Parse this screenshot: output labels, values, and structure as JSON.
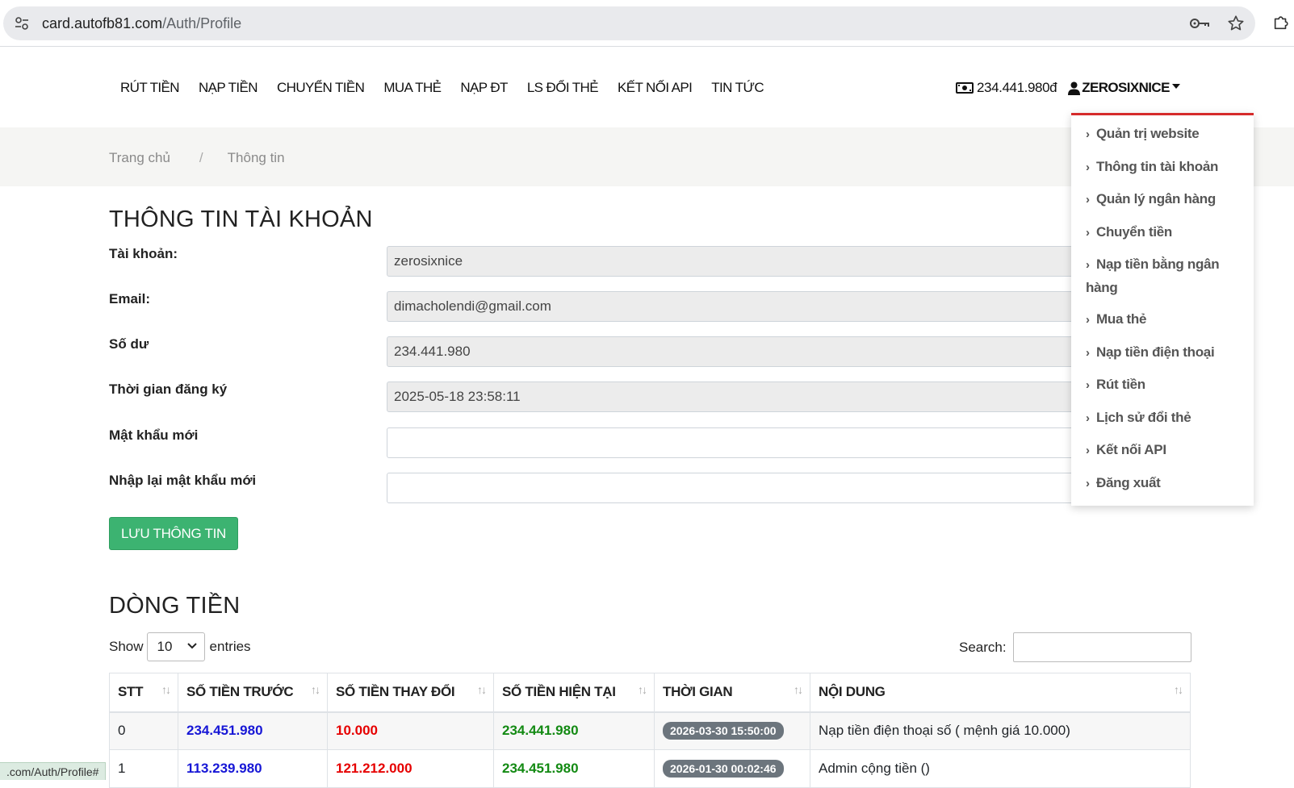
{
  "browser": {
    "url_host": "card.autofb81.com",
    "url_path": "/Auth/Profile",
    "status_url": ".com/Auth/Profile#"
  },
  "nav": {
    "links": [
      "RÚT TIỀN",
      "NẠP TIỀN",
      "CHUYỂN TIỀN",
      "MUA THẺ",
      "NẠP ĐT",
      "LS ĐỔI THẺ",
      "KẾT NỐI API",
      "TIN TỨC"
    ],
    "balance": "234.441.980đ",
    "username": "ZEROSIXNICE"
  },
  "breadcrumb": {
    "home": "Trang chủ",
    "separator": "/",
    "current": "Thông tin"
  },
  "account": {
    "title": "THÔNG TIN TÀI KHOẢN",
    "fields": [
      {
        "label": "Tài khoản:",
        "value": "zerosixnice"
      },
      {
        "label": "Email:",
        "value": "dimacholendi@gmail.com"
      },
      {
        "label": "Số dư",
        "value": "234.441.980"
      },
      {
        "label": "Thời gian đăng ký",
        "value": "2025-05-18 23:58:11"
      },
      {
        "label": "Mật khẩu mới",
        "value": ""
      },
      {
        "label": "Nhập lại mật khẩu mới",
        "value": ""
      }
    ],
    "save_label": "LƯU THÔNG TIN"
  },
  "cashflow": {
    "title": "DÒNG TIỀN",
    "show_label": "Show",
    "show_value": "10",
    "entries_label": "entries",
    "search_label": "Search:",
    "columns": [
      "STT",
      "SỐ TIỀN TRƯỚC",
      "SỐ TIỀN THAY ĐỔI",
      "SỐ TIỀN HIỆN TẠI",
      "THỜI GIAN",
      "NỘI DUNG"
    ],
    "rows": [
      {
        "stt": "0",
        "before": "234.451.980",
        "change": "10.000",
        "after": "234.441.980",
        "time": "2026-03-30 15:50:00",
        "content": "Nạp tiền điện thoại số ( mệnh giá 10.000)"
      },
      {
        "stt": "1",
        "before": "113.239.980",
        "change": "121.212.000",
        "after": "234.451.980",
        "time": "2026-01-30 00:02:46",
        "content": "Admin cộng tiền ()"
      }
    ]
  },
  "user_menu": {
    "items": [
      "Quản trị website",
      "Thông tin tài khoản",
      "Quản lý ngân hàng",
      "Chuyển tiền",
      "Nạp tiền bằng ngân hàng",
      "Mua thẻ",
      "Nạp tiền điện thoại",
      "Rút tiền",
      "Lịch sử đổi thẻ",
      "Kết nối API",
      "Đăng xuất"
    ]
  },
  "colors": {
    "accent_red": "#d52b2b",
    "save_green": "#3cb371",
    "amount_blue": "#1717d6",
    "amount_red": "#e60000",
    "amount_green": "#138a13",
    "badge_gray": "#6c757d"
  },
  "icons": {
    "site": "tune-icon",
    "key": "key-icon",
    "star": "star-icon",
    "extension": "puzzle-icon",
    "balance": "money-icon",
    "user": "user-icon"
  }
}
